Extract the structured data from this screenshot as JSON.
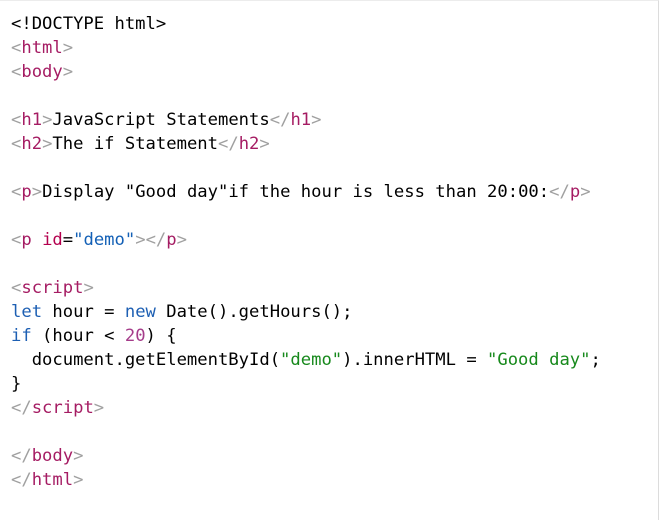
{
  "editor": {
    "lines": [
      [
        {
          "t": "<!DOCTYPE html>",
          "c": "txt"
        }
      ],
      [
        {
          "t": "<",
          "c": "br"
        },
        {
          "t": "html",
          "c": "tag"
        },
        {
          "t": ">",
          "c": "br"
        }
      ],
      [
        {
          "t": "<",
          "c": "br"
        },
        {
          "t": "body",
          "c": "tag"
        },
        {
          "t": ">",
          "c": "br"
        }
      ],
      [],
      [
        {
          "t": "<",
          "c": "br"
        },
        {
          "t": "h1",
          "c": "tag"
        },
        {
          "t": ">",
          "c": "br"
        },
        {
          "t": "JavaScript Statements",
          "c": "txt"
        },
        {
          "t": "</",
          "c": "br"
        },
        {
          "t": "h1",
          "c": "tag"
        },
        {
          "t": ">",
          "c": "br"
        }
      ],
      [
        {
          "t": "<",
          "c": "br"
        },
        {
          "t": "h2",
          "c": "tag"
        },
        {
          "t": ">",
          "c": "br"
        },
        {
          "t": "The if Statement",
          "c": "txt"
        },
        {
          "t": "</",
          "c": "br"
        },
        {
          "t": "h2",
          "c": "tag"
        },
        {
          "t": ">",
          "c": "br"
        }
      ],
      [],
      [
        {
          "t": "<",
          "c": "br"
        },
        {
          "t": "p",
          "c": "tag"
        },
        {
          "t": ">",
          "c": "br"
        },
        {
          "t": "Display \"Good day\"if the hour is less than 20:00:",
          "c": "txt"
        },
        {
          "t": "</",
          "c": "br"
        },
        {
          "t": "p",
          "c": "tag"
        },
        {
          "t": ">",
          "c": "br"
        }
      ],
      [],
      [
        {
          "t": "<",
          "c": "br"
        },
        {
          "t": "p",
          "c": "tag"
        },
        {
          "t": " ",
          "c": "txt"
        },
        {
          "t": "id",
          "c": "attr"
        },
        {
          "t": "=",
          "c": "txt"
        },
        {
          "t": "\"demo\"",
          "c": "attrv"
        },
        {
          "t": "></",
          "c": "br"
        },
        {
          "t": "p",
          "c": "tag"
        },
        {
          "t": ">",
          "c": "br"
        }
      ],
      [],
      [
        {
          "t": "<",
          "c": "br"
        },
        {
          "t": "script",
          "c": "tag"
        },
        {
          "t": ">",
          "c": "br"
        }
      ],
      [
        {
          "t": "let",
          "c": "kw"
        },
        {
          "t": " hour = ",
          "c": "txt"
        },
        {
          "t": "new",
          "c": "kw"
        },
        {
          "t": " Date().getHours();",
          "c": "txt"
        }
      ],
      [
        {
          "t": "if",
          "c": "kw"
        },
        {
          "t": " (hour < ",
          "c": "txt"
        },
        {
          "t": "20",
          "c": "num"
        },
        {
          "t": ") {",
          "c": "txt"
        }
      ],
      [
        {
          "t": "  document.getElementById(",
          "c": "txt"
        },
        {
          "t": "\"demo\"",
          "c": "str"
        },
        {
          "t": ").innerHTML = ",
          "c": "txt"
        },
        {
          "t": "\"Good day\"",
          "c": "str"
        },
        {
          "t": ";",
          "c": "txt"
        }
      ],
      [
        {
          "t": "}",
          "c": "txt"
        }
      ],
      [
        {
          "t": "</",
          "c": "br"
        },
        {
          "t": "script",
          "c": "tag"
        },
        {
          "t": ">",
          "c": "br"
        }
      ],
      [],
      [
        {
          "t": "</",
          "c": "br"
        },
        {
          "t": "body",
          "c": "tag"
        },
        {
          "t": ">",
          "c": "br"
        }
      ],
      [
        {
          "t": "</",
          "c": "br"
        },
        {
          "t": "html",
          "c": "tag"
        },
        {
          "t": ">",
          "c": "br"
        }
      ]
    ]
  }
}
